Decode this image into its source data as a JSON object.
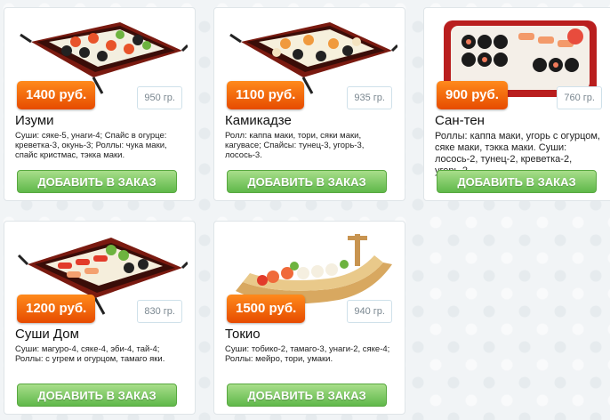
{
  "products": [
    {
      "name": "Изуми",
      "price": "1400 руб.",
      "weight": "950 гр.",
      "desc": "Суши: сяке-5, унаги-4; Спайс в огурце: креветка-3, окунь-3; Роллы: чука маки, спайс кристмас, тэкка маки.",
      "button": "ДОБАВИТЬ В ЗАКАЗ",
      "photo": "sushi-set-tray-image"
    },
    {
      "name": "Камикадзе",
      "price": "1100 руб.",
      "weight": "935 гр.",
      "desc": "Ролл: каппа маки, тори, сяки маки, кагувасе; Спайсы: тунец-3, угорь-3, лосось-3.",
      "button": "ДОБАВИТЬ В ЗАКАЗ",
      "photo": "sushi-set-tray-image"
    },
    {
      "name": "Сан-тен",
      "price": "900 руб.",
      "weight": "760 гр.",
      "desc": "Роллы: каппа маки, угорь с огурцом, сяке маки, тэкка маки. Суши: лосось-2, тунец-2, креветка-2, угорь-2.",
      "button": "ДОБАВИТЬ В ЗАКАЗ",
      "photo": "sushi-platter-image"
    },
    {
      "name": "Суши Дом",
      "price": "1200 руб.",
      "weight": "830 гр.",
      "desc": "Суши: магуро-4, сяке-4, эби-4, тай-4; Роллы: с угрем и огурцом, тамаго яки.",
      "button": "ДОБАВИТЬ В ЗАКАЗ",
      "photo": "sushi-set-tray-image"
    },
    {
      "name": "Токио",
      "price": "1500 руб.",
      "weight": "940 гр.",
      "desc": "Суши: тобико-2, тамаго-3, унаги-2, сяке-4; Роллы: мейро, тори, умаки.",
      "button": "ДОБАВИТЬ В ЗАКАЗ",
      "photo": "sushi-boat-image"
    }
  ]
}
